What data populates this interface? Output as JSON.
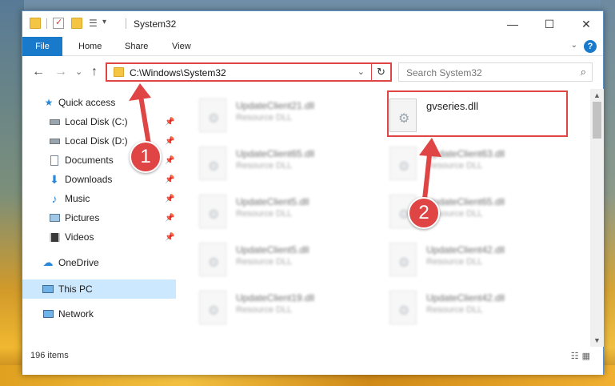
{
  "window": {
    "title": "System32",
    "ribbon_tabs": [
      "File",
      "Home",
      "Share",
      "View"
    ],
    "help_label": "?"
  },
  "nav": {
    "back": "←",
    "forward": "→",
    "recent": "⌄",
    "up": "↑",
    "address": "C:\\Windows\\System32",
    "refresh": "↻",
    "search_placeholder": "Search System32"
  },
  "sidebar": {
    "items": [
      {
        "label": "Quick access",
        "icon": "star-icon"
      },
      {
        "label": "Local Disk (C:)",
        "icon": "drive-icon",
        "pinned": true
      },
      {
        "label": "Local Disk (D:)",
        "icon": "drive-icon",
        "pinned": true
      },
      {
        "label": "Documents",
        "icon": "documents-icon",
        "pinned": true
      },
      {
        "label": "Downloads",
        "icon": "downloads-icon",
        "pinned": true
      },
      {
        "label": "Music",
        "icon": "music-icon",
        "pinned": true
      },
      {
        "label": "Pictures",
        "icon": "pictures-icon",
        "pinned": true
      },
      {
        "label": "Videos",
        "icon": "videos-icon",
        "pinned": true
      },
      {
        "label": "OneDrive",
        "icon": "cloud-icon"
      },
      {
        "label": "This PC",
        "icon": "computer-icon",
        "selected": true
      },
      {
        "label": "Network",
        "icon": "network-icon"
      }
    ]
  },
  "files": {
    "left_column": [
      {
        "name": "UpdateClient21.dll",
        "type": "Resource DLL"
      },
      {
        "name": "UpdateClient65.dll",
        "type": "Resource DLL"
      },
      {
        "name": "UpdateClient5.dll",
        "type": "Resource DLL"
      },
      {
        "name": "UpdateClient5.dll",
        "type": "Resource DLL"
      },
      {
        "name": "UpdateClient19.dll",
        "type": "Resource DLL"
      }
    ],
    "right_column": [
      {
        "name": "gvseries.dll",
        "type": ""
      },
      {
        "name": "UpdateClient63.dll",
        "type": "Resource DLL"
      },
      {
        "name": "UpdateClient65.dll",
        "type": "Resource DLL"
      },
      {
        "name": "UpdateClient42.dll",
        "type": "Resource DLL"
      },
      {
        "name": "UpdateClient42.dll",
        "type": "Resource DLL"
      }
    ]
  },
  "status": {
    "item_count": "196 items"
  },
  "annotations": {
    "badge_1": "1",
    "badge_2": "2"
  },
  "colors": {
    "accent": "#1979ca",
    "highlight": "#e04545",
    "selection": "#cce8ff"
  }
}
